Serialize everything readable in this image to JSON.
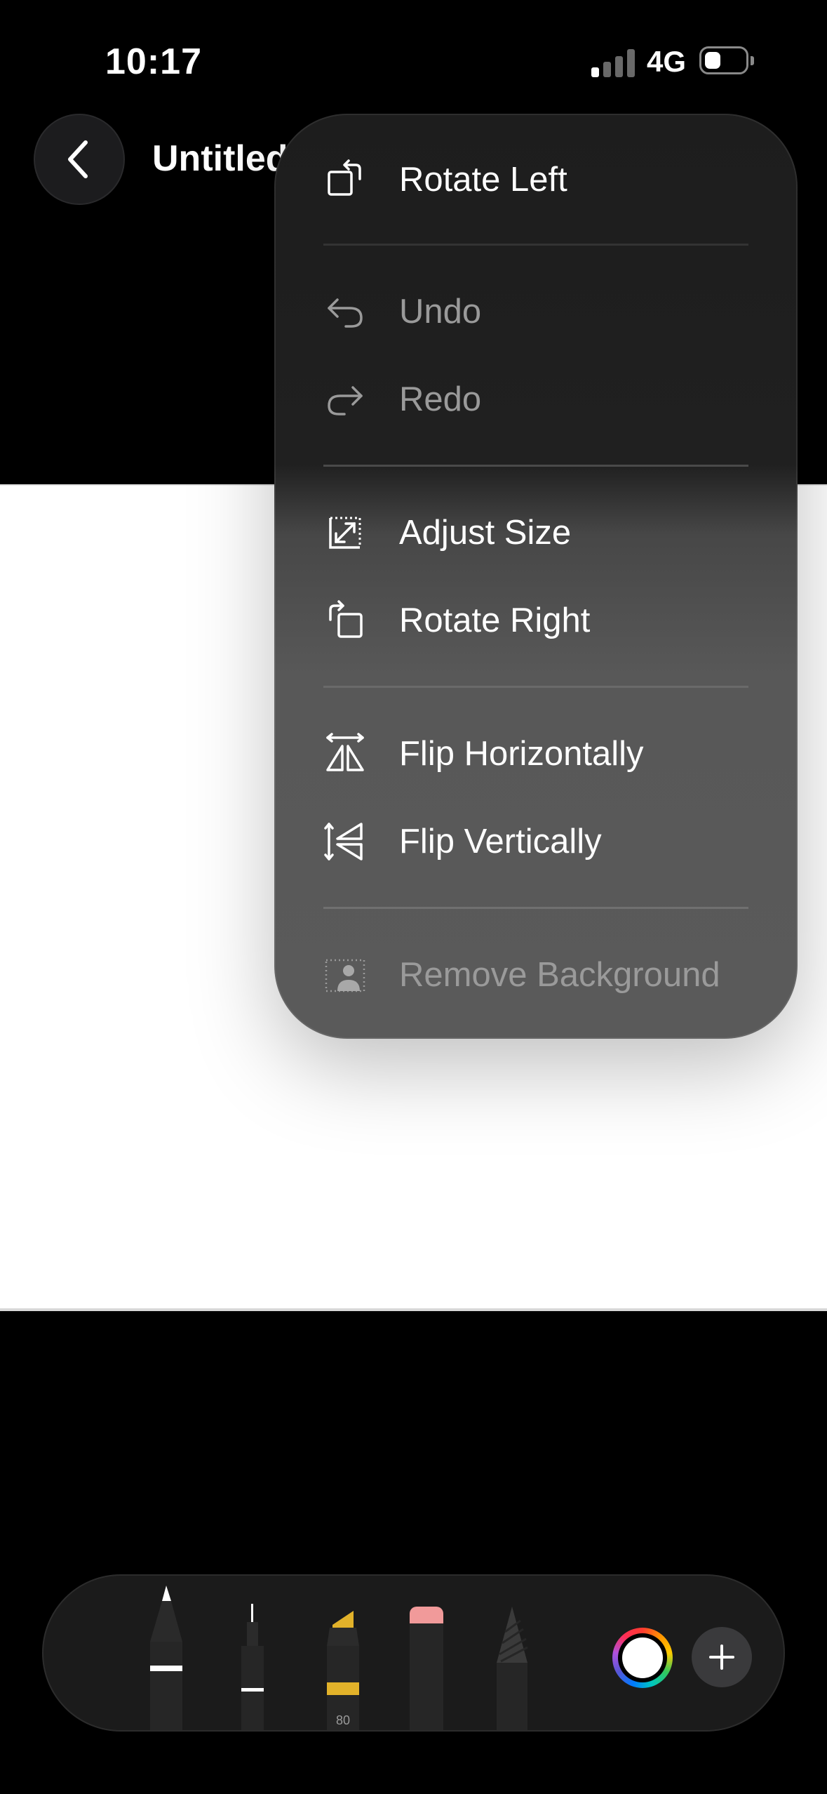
{
  "status_bar": {
    "time": "10:17",
    "network": "4G",
    "signal_bars_active": 1,
    "signal_bars_total": 4,
    "battery_level": "low"
  },
  "nav": {
    "back_icon": "chevron-left-icon",
    "title": "Untitled"
  },
  "menu": {
    "items": [
      {
        "label": "Rotate Left",
        "icon": "rotate-left-icon",
        "enabled": true
      },
      {
        "label": "Undo",
        "icon": "undo-icon",
        "enabled": false
      },
      {
        "label": "Redo",
        "icon": "redo-icon",
        "enabled": false
      },
      {
        "label": "Adjust Size",
        "icon": "resize-icon",
        "enabled": true
      },
      {
        "label": "Rotate Right",
        "icon": "rotate-right-icon",
        "enabled": true
      },
      {
        "label": "Flip Horizontally",
        "icon": "flip-horizontal-icon",
        "enabled": true
      },
      {
        "label": "Flip Vertically",
        "icon": "flip-vertical-icon",
        "enabled": true
      },
      {
        "label": "Remove Background",
        "icon": "remove-background-icon",
        "enabled": false
      }
    ]
  },
  "toolbar": {
    "tools": [
      {
        "name": "pen",
        "icon": "pen-icon",
        "selected": true
      },
      {
        "name": "fineliner",
        "icon": "fineliner-icon"
      },
      {
        "name": "marker",
        "icon": "marker-icon",
        "size_label": "80",
        "accent": "#e2b22a"
      },
      {
        "name": "eraser",
        "icon": "eraser-icon",
        "accent": "#f19a9a"
      },
      {
        "name": "pencil",
        "icon": "pencil-icon"
      }
    ],
    "current_color": "#ffffff",
    "add_icon": "plus-icon"
  }
}
